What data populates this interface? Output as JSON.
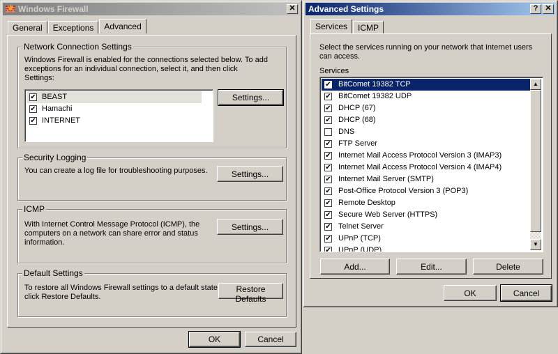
{
  "firewall": {
    "title": "Windows Firewall",
    "close_glyph": "✕",
    "tabs": [
      {
        "label": "General",
        "selected": false
      },
      {
        "label": "Exceptions",
        "selected": false
      },
      {
        "label": "Advanced",
        "selected": true
      }
    ],
    "network": {
      "legend": "Network Connection Settings",
      "description": "Windows Firewall is enabled for the connections selected below. To add exceptions for an individual connection, select it, and then click Settings:",
      "connections": [
        {
          "label": "BEAST",
          "checked": true,
          "selected": true
        },
        {
          "label": "Hamachi",
          "checked": true,
          "selected": false
        },
        {
          "label": "INTERNET",
          "checked": true,
          "selected": false
        }
      ],
      "settings_label": "Settings..."
    },
    "logging": {
      "legend": "Security Logging",
      "description": "You can create a log file for troubleshooting purposes.",
      "settings_label": "Settings..."
    },
    "icmp": {
      "legend": "ICMP",
      "description": "With Internet Control Message Protocol (ICMP), the computers on a network can share error and status information.",
      "settings_label": "Settings..."
    },
    "defaults": {
      "legend": "Default Settings",
      "description": "To restore all Windows Firewall settings to a default state, click Restore Defaults.",
      "restore_label": "Restore Defaults"
    },
    "ok_label": "OK",
    "cancel_label": "Cancel"
  },
  "advanced": {
    "title": "Advanced Settings",
    "help_glyph": "?",
    "close_glyph": "✕",
    "tabs": [
      {
        "label": "Services",
        "selected": true
      },
      {
        "label": "ICMP",
        "selected": false
      }
    ],
    "instructions": "Select the services running on your network that Internet users can access.",
    "services_label": "Services",
    "services": [
      {
        "label": "BitComet 19382 TCP",
        "checked": true,
        "selected": true
      },
      {
        "label": "BitComet 19382 UDP",
        "checked": true
      },
      {
        "label": "DHCP (67)",
        "checked": true
      },
      {
        "label": "DHCP (68)",
        "checked": true
      },
      {
        "label": "DNS",
        "checked": false
      },
      {
        "label": "FTP Server",
        "checked": true
      },
      {
        "label": "Internet Mail Access Protocol Version 3 (IMAP3)",
        "checked": true
      },
      {
        "label": "Internet Mail Access Protocol Version 4 (IMAP4)",
        "checked": true
      },
      {
        "label": "Internet Mail Server (SMTP)",
        "checked": true
      },
      {
        "label": "Post-Office Protocol Version 3 (POP3)",
        "checked": true
      },
      {
        "label": "Remote Desktop",
        "checked": true
      },
      {
        "label": "Secure Web Server (HTTPS)",
        "checked": true
      },
      {
        "label": "Telnet Server",
        "checked": true
      },
      {
        "label": "UPnP (TCP)",
        "checked": true
      },
      {
        "label": "UPnP (UDP)",
        "checked": true
      }
    ],
    "scroll_up_glyph": "▲",
    "scroll_down_glyph": "▼",
    "add_label": "Add...",
    "edit_label": "Edit...",
    "delete_label": "Delete",
    "ok_label": "OK",
    "cancel_label": "Cancel"
  },
  "colors": {
    "face": "#d4d0c8",
    "active_title": "#0a246a",
    "inactive_title": "#808080",
    "selection": "#0a246a"
  }
}
